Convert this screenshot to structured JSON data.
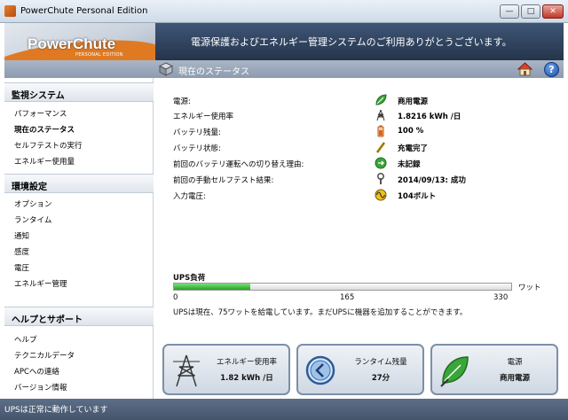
{
  "window": {
    "title": "PowerChute Personal Edition"
  },
  "header": {
    "logo_text": "PowerChute",
    "logo_sub": "PERSONAL EDITION",
    "welcome": "電源保護およびエネルギー管理システムのご利用ありがとうございます。"
  },
  "subheader": {
    "title": "現在のステータス"
  },
  "sidebar": {
    "sections": [
      {
        "heading": "監視システム",
        "items": [
          "パフォーマンス",
          "現在のステータス",
          "セルフテストの実行",
          "エネルギー使用量"
        ]
      },
      {
        "heading": "環境設定",
        "items": [
          "オプション",
          "ランタイム",
          "通知",
          "感度",
          "電圧",
          "エネルギー管理"
        ]
      },
      {
        "heading": "ヘルプとサポート",
        "items": [
          "ヘルプ",
          "テクニカルデータ",
          "APCへの連絡",
          "バージョン情報"
        ]
      }
    ],
    "active_item": "現在のステータス"
  },
  "status": {
    "rows": [
      {
        "label": "電源:",
        "value": "商用電源",
        "icon": "plug-leaf-icon"
      },
      {
        "label": "エネルギー使用率",
        "value": "1.8216 kWh /日",
        "icon": "power-tower-icon"
      },
      {
        "label": "バッテリ残量:",
        "value": "100 %",
        "icon": "battery-icon"
      },
      {
        "label": "バッテリ状態:",
        "value": "充電完了",
        "icon": "charge-icon"
      },
      {
        "label": "前回のバッテリ運転への切り替え理由:",
        "value": "未記録",
        "icon": "switch-icon"
      },
      {
        "label": "前回の手動セルフテスト結果:",
        "value": "2014/09/13: 成功",
        "icon": "wrench-icon"
      },
      {
        "label": "入力電圧:",
        "value": "104ボルト",
        "icon": "voltage-icon"
      }
    ]
  },
  "ups_load": {
    "title": "UPS負荷",
    "unit": "ワット",
    "ticks": [
      "0",
      "165",
      "330"
    ],
    "max": 330,
    "value": 75,
    "message": "UPSは現在、75ワットを給電しています。まだUPSに機器を追加することができます。"
  },
  "panels": [
    {
      "label": "エネルギー使用率",
      "value": "1.82 kWh /日",
      "icon": "power-tower-icon"
    },
    {
      "label": "ランタイム残量",
      "value": "27分",
      "icon": "runtime-clock-icon"
    },
    {
      "label": "電源",
      "value": "商用電源",
      "icon": "plug-leaf-icon"
    }
  ],
  "statusbar": {
    "text": "UPSは正常に動作しています"
  },
  "colors": {
    "accent_orange": "#e07a22",
    "header_navy": "#25344b",
    "load_green": "#1fa51f"
  }
}
